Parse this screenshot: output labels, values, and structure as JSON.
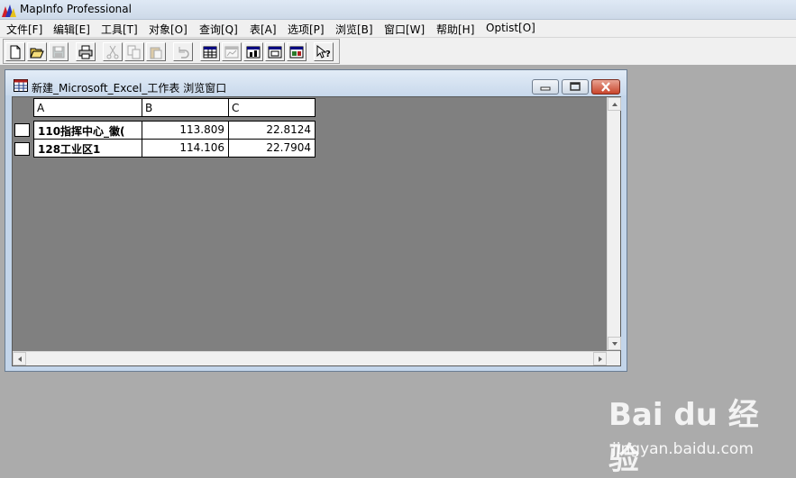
{
  "app": {
    "title": "MapInfo Professional"
  },
  "menu": [
    "文件[F]",
    "编辑[E]",
    "工具[T]",
    "对象[O]",
    "查询[Q]",
    "表[A]",
    "选项[P]",
    "浏览[B]",
    "窗口[W]",
    "帮助[H]",
    "Optist[O]"
  ],
  "toolbar": {
    "buttons": [
      "new-icon",
      "open-icon",
      "save-icon",
      "print-icon",
      "cut-icon",
      "copy-icon",
      "paste-icon",
      "undo-icon",
      "browser-window-icon",
      "map-window-icon",
      "graph-window-icon",
      "layout-window-icon",
      "redistrict-window-icon",
      "help-pointer-icon"
    ]
  },
  "browser": {
    "title": "新建_Microsoft_Excel_工作表 浏览窗口",
    "columns": [
      "A",
      "B",
      "C"
    ],
    "rows": [
      {
        "a": "110指挥中心_徽(",
        "b": "113.809",
        "c": "22.8124"
      },
      {
        "a": "128工业区1",
        "b": "114.106",
        "c": "22.7904"
      }
    ]
  },
  "watermark": {
    "brand": "Bai du 经验",
    "url": "jingyan.baidu.com"
  },
  "colors": {
    "mdi_background": "#ababab",
    "client_background": "#808080",
    "window_frame": "#c3d5ea",
    "close_button": "#c9452c"
  }
}
